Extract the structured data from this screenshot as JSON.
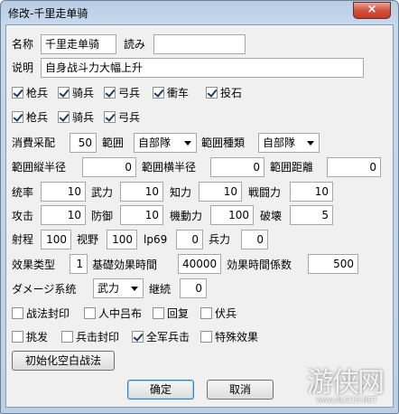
{
  "window": {
    "title": "修改-千里走单骑",
    "close_label": "×"
  },
  "row_name": {
    "name_label": "名称",
    "name_value": "千里走单骑",
    "read_label": "読み",
    "read_value": ""
  },
  "row_desc": {
    "label": "说明",
    "value": "自身战斗力大幅上升"
  },
  "checks_row1": [
    {
      "label": "枪兵",
      "checked": true
    },
    {
      "label": "骑兵",
      "checked": true
    },
    {
      "label": "弓兵",
      "checked": true
    },
    {
      "label": "衝车",
      "checked": true
    },
    {
      "label": "投石",
      "checked": true
    }
  ],
  "checks_row2": [
    {
      "label": "枪兵",
      "checked": true
    },
    {
      "label": "骑兵",
      "checked": true
    },
    {
      "label": "弓兵",
      "checked": true
    }
  ],
  "row_cost": {
    "cost_label": "消費采配",
    "cost_value": "50",
    "range_label": "範囲",
    "range_value": "自部隊",
    "range_type_label": "範囲種類",
    "range_type_value": "自部隊"
  },
  "row_radius": {
    "v_label": "範囲縦半径",
    "v_value": "0",
    "h_label": "範囲横半径",
    "h_value": "0",
    "d_label": "範囲距離",
    "d_value": "0"
  },
  "row_stats1": [
    {
      "label": "统率",
      "value": "10"
    },
    {
      "label": "武力",
      "value": "10"
    },
    {
      "label": "知力",
      "value": "10"
    },
    {
      "label": "戦闘力",
      "value": "10"
    }
  ],
  "row_stats2": [
    {
      "label": "攻击",
      "value": "10"
    },
    {
      "label": "防御",
      "value": "10"
    },
    {
      "label": "機動力",
      "value": "100"
    },
    {
      "label": "破壊",
      "value": "5"
    }
  ],
  "row_stats3": [
    {
      "label": "射程",
      "value": "100"
    },
    {
      "label": "视野",
      "value": "100"
    },
    {
      "label": "lp69",
      "value": "0"
    },
    {
      "label": "兵力",
      "value": "0"
    }
  ],
  "row_effect": {
    "type_label": "效果类型",
    "type_value": "1",
    "time_label": "基礎効果時間",
    "time_value": "40000",
    "coef_label": "効果時間係数",
    "coef_value": "500"
  },
  "row_damage": {
    "label": "ダメージ系统",
    "select_value": "武力",
    "continue_label": "継続",
    "continue_value": "0"
  },
  "checks_row3": [
    {
      "label": "战法封印",
      "checked": false
    },
    {
      "label": "人中吕布",
      "checked": false
    },
    {
      "label": "回复",
      "checked": false
    },
    {
      "label": "伏兵",
      "checked": false
    }
  ],
  "checks_row4": [
    {
      "label": "挑发",
      "checked": false
    },
    {
      "label": "兵击封印",
      "checked": false
    },
    {
      "label": "全军兵击",
      "checked": true
    },
    {
      "label": "特殊效果",
      "checked": false
    }
  ],
  "buttons": {
    "init_label": "初始化空白战法",
    "ok_label": "确定",
    "cancel_label": "取消"
  },
  "watermark": {
    "text": "游侠网",
    "url": "www.ALI213.NET"
  }
}
